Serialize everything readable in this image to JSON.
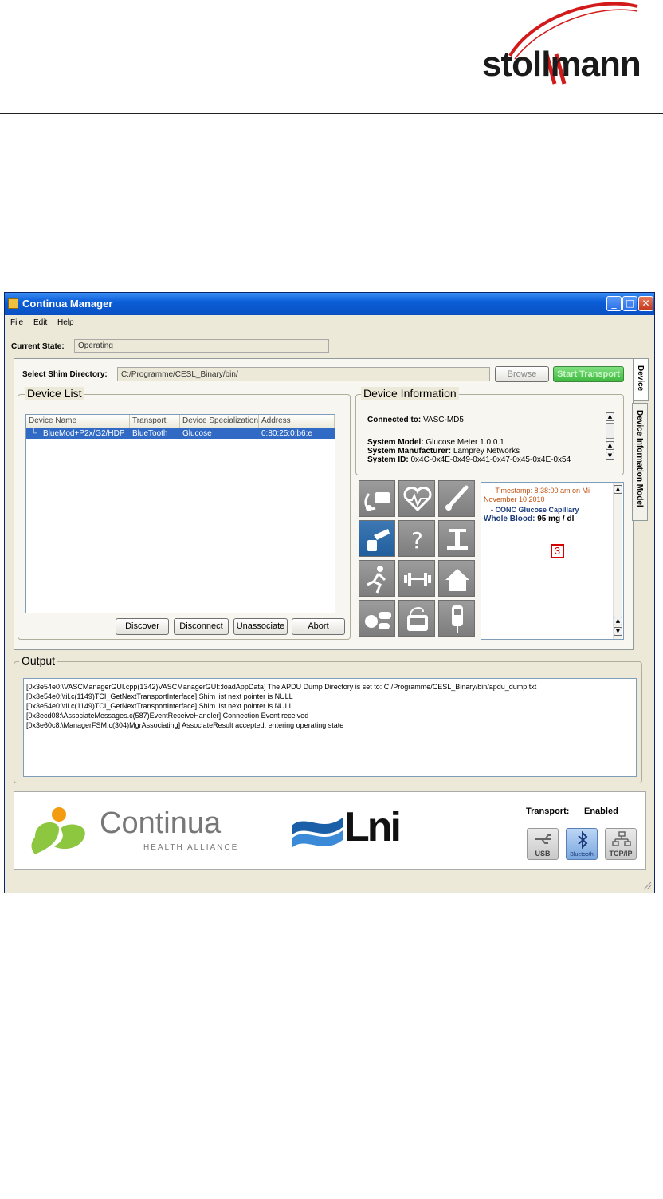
{
  "header": {
    "logo_text": "stollmann"
  },
  "window": {
    "title": "Continua Manager",
    "menu": [
      "File",
      "Edit",
      "Help"
    ],
    "current_state_label": "Current State:",
    "current_state_value": "Operating",
    "shim_label": "Select Shim Directory:",
    "shim_path": "C:/Programme/CESL_Binary/bin/",
    "browse_label": "Browse",
    "start_transport_label": "Start Transport",
    "tabs": [
      "Device",
      "Device Information Model"
    ],
    "colors": {
      "titlebar": "#0b5ed7",
      "start_transport": "#4ec34e",
      "selected_row": "#316ac5",
      "highlight_box": "#d40000"
    }
  },
  "device_list": {
    "title": "Device List",
    "columns": [
      "Device Name",
      "Transport",
      "Device Specialization(",
      "Address"
    ],
    "rows": [
      {
        "name": "BlueMod+P2x/G2/HDP",
        "transport": "BlueTooth",
        "specialization": "Glucose",
        "address": "0:80:25:0:b6:e"
      }
    ],
    "buttons": [
      "Discover",
      "Disconnect",
      "Unassociate",
      "Abort"
    ]
  },
  "device_info": {
    "title": "Device Information",
    "connected_label": "Connected to:",
    "connected_value": "VASC-MD5",
    "model_label": "System Model:",
    "model_value": "Glucose Meter 1.0.0.1",
    "manufacturer_label": "System Manufacturer:",
    "manufacturer_value": "Lamprey Networks",
    "id_label": "System ID:",
    "id_value": "0x4C-0x4E-0x49-0x41-0x47-0x45-0x4E-0x54"
  },
  "measurement": {
    "timestamp_line1": "- Timestamp: 8:38:00 am on Mi",
    "timestamp_line2": "November 10 2010",
    "type": "- CONC Glucose Capillary",
    "label": "Whole Blood:",
    "value": "95 mg / dl",
    "marker": "3"
  },
  "device_icons": [
    "blood-pressure-icon",
    "heart-rate-icon",
    "thermometer-icon",
    "glucose-meter-icon",
    "unknown-icon",
    "weighing-scale-icon",
    "activity-icon",
    "strength-fitness-icon",
    "independent-living-icon",
    "medication-icon",
    "insulin-pump-icon",
    "peak-flow-icon"
  ],
  "output": {
    "title": "Output",
    "lines": [
      "[0x3e54e0:\\VASCManagerGUI.cpp(1342)VASCManagerGUI::loadAppData]  The APDU Dump Directory is set to: C:/Programme/CESL_Binary/bin/apdu_dump.txt",
      "[0x3e54e0:\\til.c(1149)TCI_GetNextTransportInterface] Shim list next pointer is NULL",
      "[0x3e54e0:\\til.c(1149)TCI_GetNextTransportInterface] Shim list next pointer is NULL",
      "[0x3ecd08:\\AssociateMessages.c(587)EventReceiveHandler] Connection Event received",
      "[0x3e60c8:\\ManagerFSM.c(304)MgrAssociating] AssociateResult accepted, entering operating state"
    ]
  },
  "footer": {
    "continua_text": "Continua",
    "continua_sub": "HEALTH ALLIANCE",
    "lni_text": "Lni",
    "transport_label": "Transport:",
    "transport_status": "Enabled",
    "transports": [
      {
        "label": "USB",
        "active": false
      },
      {
        "label": "Bluetooth",
        "active": true
      },
      {
        "label": "TCP/IP",
        "active": false
      }
    ]
  }
}
